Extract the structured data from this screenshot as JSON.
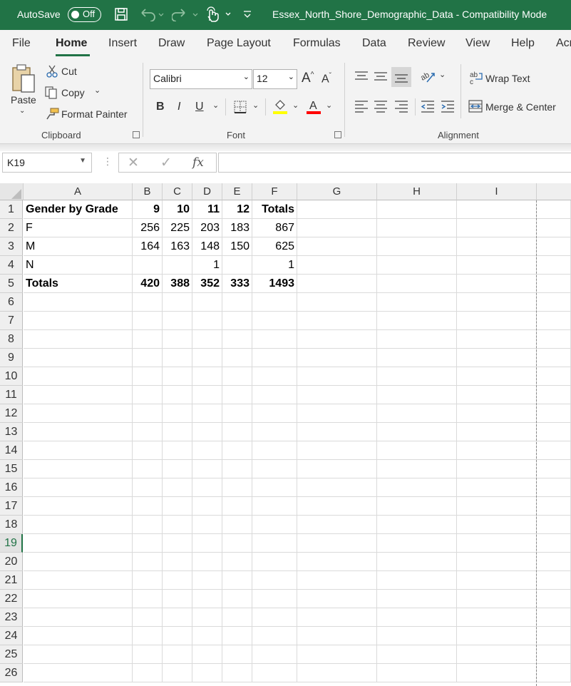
{
  "titlebar": {
    "autosave_label": "AutoSave",
    "autosave_state": "Off",
    "document_title": "Essex_North_Shore_Demographic_Data  -  Compatibility Mode",
    "accent": "#217346"
  },
  "tabs": [
    "File",
    "Home",
    "Insert",
    "Draw",
    "Page Layout",
    "Formulas",
    "Data",
    "Review",
    "View",
    "Help",
    "Acr"
  ],
  "active_tab": "Home",
  "clipboard": {
    "paste": "Paste",
    "cut": "Cut",
    "copy": "Copy",
    "format_painter": "Format Painter",
    "group_label": "Clipboard"
  },
  "font": {
    "font_name": "Calibri",
    "font_size": "12",
    "bold": "B",
    "italic": "I",
    "underline": "U",
    "group_label": "Font",
    "fill_color": "#ffff00",
    "font_color": "#ff0000"
  },
  "alignment": {
    "wrap_text": "Wrap Text",
    "merge_center": "Merge & Center",
    "group_label": "Alignment"
  },
  "formula_bar": {
    "name_box": "K19",
    "fx": "fx",
    "content": ""
  },
  "columns": [
    "A",
    "B",
    "C",
    "D",
    "E",
    "F",
    "G",
    "H",
    "I"
  ],
  "rows": [
    "1",
    "2",
    "3",
    "4",
    "5",
    "6",
    "7",
    "8",
    "9",
    "10",
    "11",
    "12",
    "13",
    "14",
    "15",
    "16",
    "17",
    "18",
    "19",
    "20",
    "21",
    "22",
    "23",
    "24",
    "25",
    "26"
  ],
  "selected_row": "19",
  "sheet": {
    "row1": [
      "Gender by Grade",
      "9",
      "10",
      "11",
      "12",
      "Totals"
    ],
    "row2": [
      "F",
      "256",
      "225",
      "203",
      "183",
      "867"
    ],
    "row3": [
      "M",
      "164",
      "163",
      "148",
      "150",
      "625"
    ],
    "row4": [
      "N",
      "",
      "",
      "1",
      "",
      "1"
    ],
    "row5": [
      "Totals",
      "420",
      "388",
      "352",
      "333",
      "1493"
    ]
  }
}
